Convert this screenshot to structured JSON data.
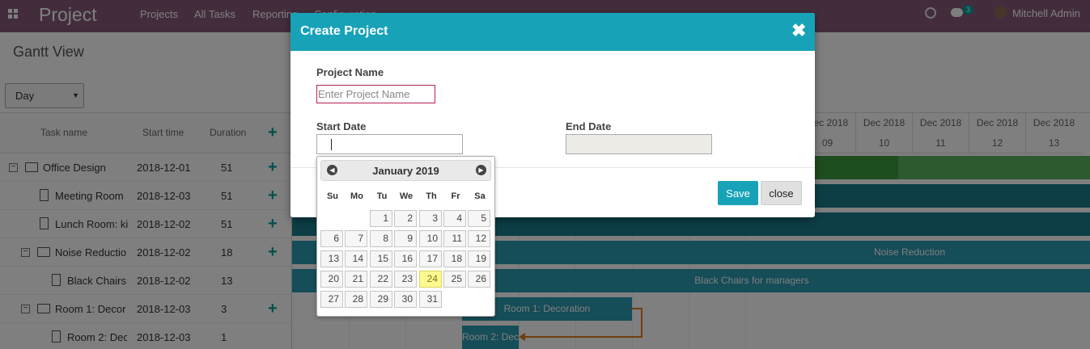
{
  "navbar": {
    "app_title": "Project",
    "menu": [
      "Projects",
      "All Tasks",
      "Reporting",
      "Configuration"
    ],
    "chat_count": "3",
    "user_name": "Mitchell Admin"
  },
  "control_panel": {
    "title": "Gantt View",
    "scale_value": "Day"
  },
  "gantt": {
    "headers": {
      "task_name": "Task name",
      "start_time": "Start time",
      "duration": "Duration"
    },
    "rows": [
      {
        "name": "Office Design",
        "start": "2018-12-01",
        "duration": "51"
      },
      {
        "name": "Meeting Room",
        "start": "2018-12-03",
        "duration": "51"
      },
      {
        "name": "Lunch Room: ki",
        "start": "2018-12-02",
        "duration": "51"
      },
      {
        "name": "Noise Reductio",
        "start": "2018-12-02",
        "duration": "18"
      },
      {
        "name": "Black Chairs",
        "start": "2018-12-02",
        "duration": "13"
      },
      {
        "name": "Room 1: Decor",
        "start": "2018-12-03",
        "duration": "3"
      },
      {
        "name": "Room 2: Dec",
        "start": "2018-12-03",
        "duration": "1"
      }
    ],
    "date_columns": [
      {
        "month": "Dec 2018",
        "day": "09"
      },
      {
        "month": "Dec 2018",
        "day": "10"
      },
      {
        "month": "Dec 2018",
        "day": "11"
      },
      {
        "month": "Dec 2018",
        "day": "12"
      },
      {
        "month": "Dec 2018",
        "day": "13"
      }
    ],
    "bars": {
      "noise_reduction": "Noise Reduction",
      "black_chairs": "Black Chairs for managers",
      "room1": "Room 1: Decoration",
      "room2": "Room 2: Dec"
    },
    "colors": {
      "green": "#4caf50",
      "teal_dark": "#1a7d8c",
      "teal": "#2a9bb0",
      "link": "#e07b1a"
    }
  },
  "modal": {
    "title": "Create Project",
    "project_name_label": "Project Name",
    "project_name_placeholder": "Enter Project Name",
    "project_name_value": "",
    "start_date_label": "Start Date",
    "end_date_label": "End Date",
    "save_label": "Save",
    "close_label": "close",
    "accent_color": "#17a2b8"
  },
  "datepicker": {
    "month_title": "January 2019",
    "weekdays": [
      "Su",
      "Mo",
      "Tu",
      "We",
      "Th",
      "Fr",
      "Sa"
    ],
    "first_weekday_index": 2,
    "days_in_month": 31,
    "today": 24
  }
}
